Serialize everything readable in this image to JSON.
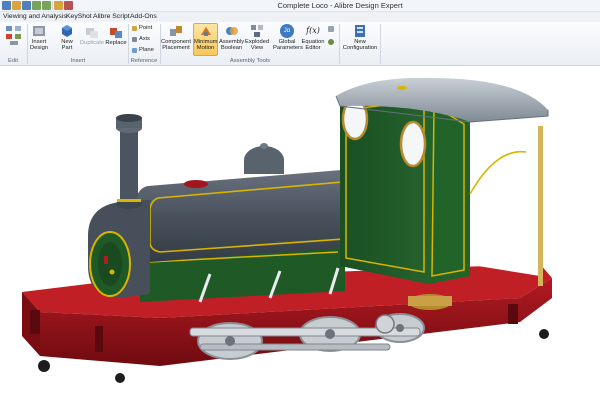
{
  "window": {
    "title": "Complete Loco - Alibre Design Expert"
  },
  "menu_tabs": [
    "Viewing and Analysis",
    "KeyShot",
    "Alibre Script",
    "Add-Ons"
  ],
  "ribbon": {
    "groups": {
      "edit": "Edit",
      "insert": "Insert",
      "reference": "Reference",
      "assembly_tools": "Assembly Tools"
    },
    "buttons": {
      "insert_design_line1": "Insert",
      "insert_design_line2": "Design",
      "new_part_line1": "New",
      "new_part_line2": "Part",
      "duplicate": "Duplicate",
      "replace": "Replace",
      "point": "Point",
      "axis": "Axis",
      "plane": "Plane",
      "component_placement_line1": "Component",
      "component_placement_line2": "Placement",
      "minimum_motion_line1": "Minimum",
      "minimum_motion_line2": "Motion",
      "assembly_boolean_line1": "Assembly",
      "assembly_boolean_line2": "Boolean",
      "exploded_view_line1": "Exploded",
      "exploded_view_line2": "View",
      "global_parameters_line1": "Global",
      "global_parameters_line2": "Parameters",
      "equation_editor_line1": "Equation",
      "equation_editor_line2": "Editor",
      "new_configuration_line1": "New",
      "new_configuration_line2": "Configuration"
    },
    "icon_glyphs": {
      "global_parameters": "Jα",
      "equation_editor": "f(x)"
    }
  },
  "model": {
    "name": "Complete Loco",
    "colors": {
      "frame": "#9b1219",
      "tank": "#4b5563",
      "cab": "#1f5a26",
      "lining": "#d9b400",
      "roof": "#8f9aa4",
      "brass": "#b88a2e",
      "steel": "#b8bdc3"
    }
  }
}
